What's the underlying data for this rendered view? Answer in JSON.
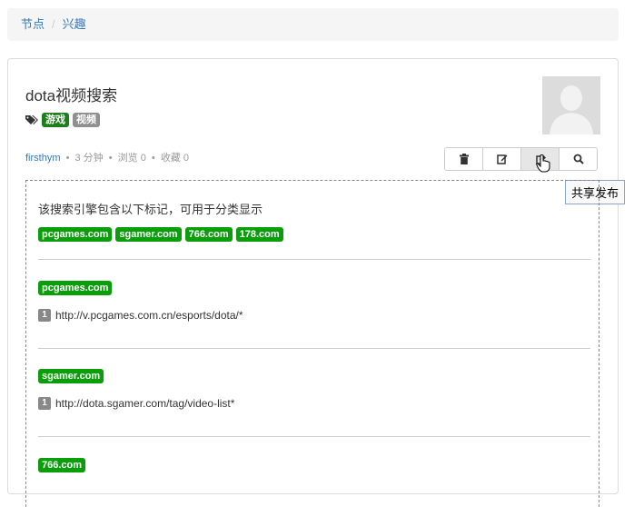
{
  "breadcrumb": {
    "items": [
      "节点",
      "兴趣"
    ]
  },
  "engine": {
    "title": "dota视频搜索",
    "tags": [
      "游戏",
      "视频"
    ],
    "author": "firsthym",
    "time": "3 分钟",
    "views": "浏览 0",
    "favorites": "收藏 0"
  },
  "toolbar": {
    "buttons": [
      "delete-icon",
      "edit-icon",
      "share-icon",
      "search-icon"
    ],
    "tooltip": "共享发布"
  },
  "content": {
    "description": "该搜索引擎包含以下标记，可用于分类显示",
    "marks": [
      "pcgames.com",
      "sgamer.com",
      "766.com",
      "178.com"
    ],
    "sections": [
      {
        "mark": "pcgames.com",
        "rules": [
          {
            "num": "1",
            "url": "http://v.pcgames.com.cn/esports/dota/*"
          }
        ]
      },
      {
        "mark": "sgamer.com",
        "rules": [
          {
            "num": "1",
            "url": "http://dota.sgamer.com/tag/video-list*"
          }
        ]
      },
      {
        "mark": "766.com",
        "rules": []
      }
    ]
  }
}
